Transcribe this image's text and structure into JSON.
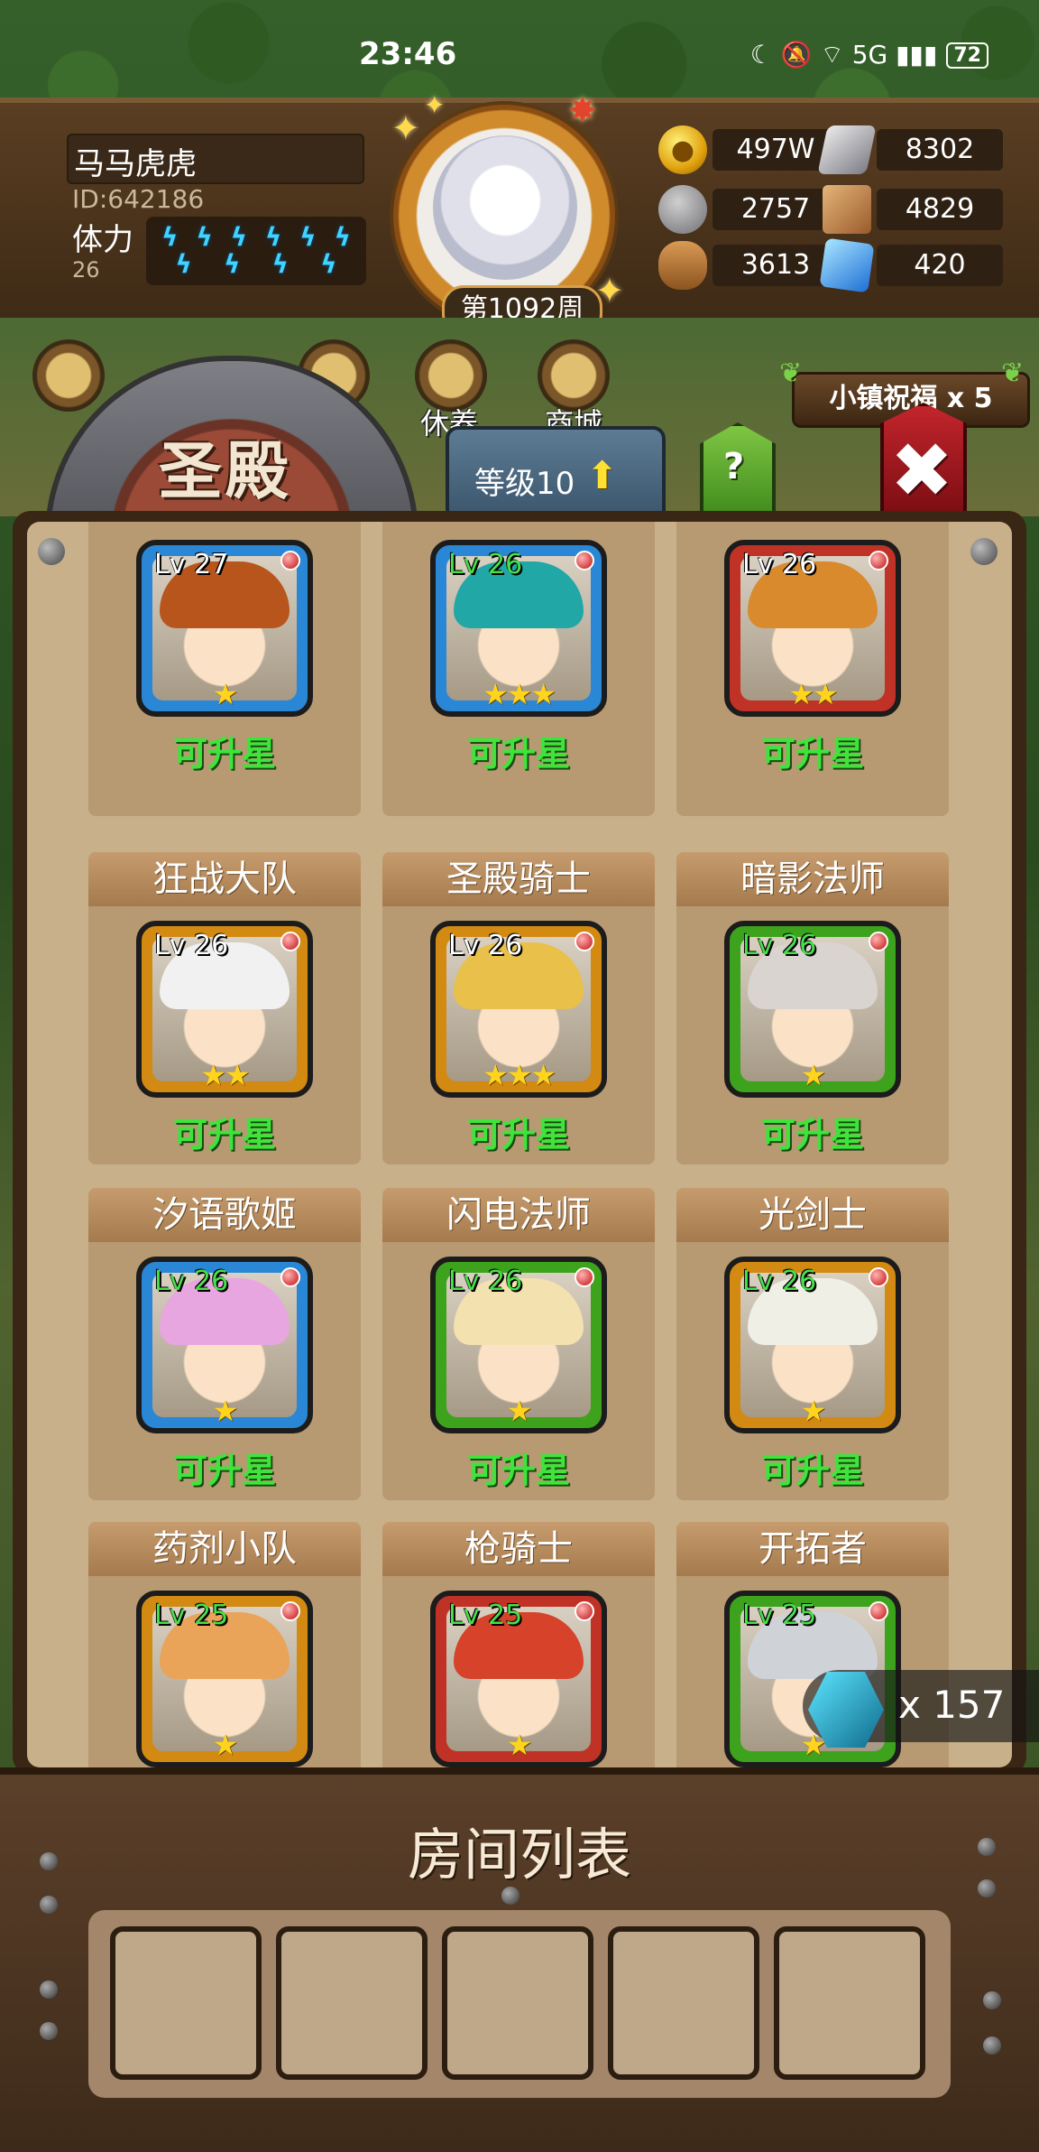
{
  "status_bar": {
    "time": "23:46",
    "icons": "☾ 🔕 ⌔ 5G ▮▮▮",
    "battery": "72"
  },
  "player": {
    "name": "马马虎虎",
    "id": "ID:642186",
    "stamina_label": "体力",
    "stamina_value": "26",
    "stamina_bolts": 5,
    "week": "第1092周"
  },
  "resources": {
    "gold": "497W",
    "iron": "8302",
    "stone": "2757",
    "map": "4829",
    "wood": "3613",
    "crystal": "420"
  },
  "top_menu": {
    "rest_label": "休养",
    "shop_label": "商城",
    "blessing": "小镇祝福 x 5"
  },
  "building": {
    "title": "圣殿",
    "level": "等级10",
    "help": "?",
    "close": "✖"
  },
  "heroes": [
    {
      "name": "",
      "level": "Lv 27",
      "stars": "★",
      "status": "可升星",
      "frame": "blue",
      "hair": "#b8551c",
      "lv_green": false
    },
    {
      "name": "",
      "level": "Lv 26",
      "stars": "★★★",
      "status": "可升星",
      "frame": "blue",
      "hair": "#20a7a6",
      "lv_green": true
    },
    {
      "name": "",
      "level": "Lv 26",
      "stars": "★★",
      "status": "可升星",
      "frame": "red",
      "hair": "#d98a2c",
      "lv_green": false
    },
    {
      "name": "狂战大队",
      "level": "Lv 26",
      "stars": "★★",
      "status": "可升星",
      "frame": "orange",
      "hair": "#f1f1f1",
      "lv_green": false
    },
    {
      "name": "圣殿骑士",
      "level": "Lv 26",
      "stars": "★★★",
      "status": "可升星",
      "frame": "orange",
      "hair": "#e8c04a",
      "lv_green": false
    },
    {
      "name": "暗影法师",
      "level": "Lv 26",
      "stars": "★",
      "status": "可升星",
      "frame": "green",
      "hair": "#d9d4cf",
      "lv_green": true
    },
    {
      "name": "汐语歌姬",
      "level": "Lv 26",
      "stars": "★",
      "status": "可升星",
      "frame": "blue",
      "hair": "#e8a6e0",
      "lv_green": true
    },
    {
      "name": "闪电法师",
      "level": "Lv 26",
      "stars": "★",
      "status": "可升星",
      "frame": "green",
      "hair": "#f3e2b0",
      "lv_green": true
    },
    {
      "name": "光剑士",
      "level": "Lv 26",
      "stars": "★",
      "status": "可升星",
      "frame": "orange",
      "hair": "#efefe6",
      "lv_green": true
    },
    {
      "name": "药剂小队",
      "level": "Lv 25",
      "stars": "★",
      "status": "",
      "frame": "orange",
      "hair": "#e9a45a",
      "lv_green": true
    },
    {
      "name": "枪骑士",
      "level": "Lv 25",
      "stars": "★",
      "status": "",
      "frame": "red",
      "hair": "#d6422a",
      "lv_green": true
    },
    {
      "name": "开拓者",
      "level": "Lv 25",
      "stars": "★",
      "status": "",
      "frame": "green",
      "hair": "#cfd3d8",
      "lv_green": true
    }
  ],
  "counter": {
    "text": "x 157",
    "icon": "hex-eye-icon"
  },
  "room_list": {
    "title": "房间列表",
    "slot_count": 5
  }
}
